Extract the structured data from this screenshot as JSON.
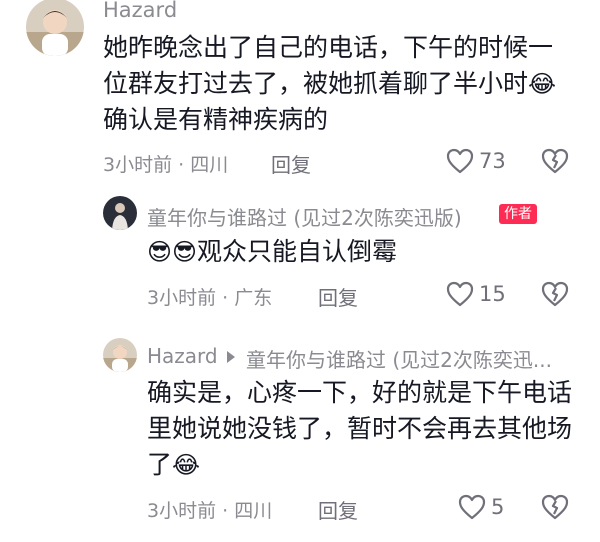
{
  "comments": [
    {
      "username": "Hazard",
      "text_lines": [
        "她昨晚念出了自己的电话，下午的时候一",
        "位群友打过去了，被她抓着聊了半小时",
        "确认是有精神疾病的"
      ],
      "emoji": "😂",
      "time": "3小时前 · 四川",
      "reply_label": "回复",
      "like_count": "73"
    },
    {
      "username": "童年你与谁路过 (见过2次陈奕迅版)",
      "badge": "作者",
      "emoji_prefix": "😎😎",
      "text": "观众只能自认倒霉",
      "time": "3小时前 · 广东",
      "reply_label": "回复",
      "like_count": "15"
    },
    {
      "username": "Hazard",
      "reply_to": "童年你与谁路过 (见过2次陈奕迅...",
      "text_lines": [
        "确实是，心疼一下，好的就是下午电话",
        "里她说她没钱了，暂时不会再去其他场",
        "了"
      ],
      "emoji": "😂",
      "time": "3小时前 · 四川",
      "reply_label": "回复",
      "like_count": "5"
    }
  ],
  "colors": {
    "meta_gray": "#8a8b91",
    "text_dark": "#161823",
    "badge_red": "#fe2c55"
  },
  "icons": [
    "heart-icon",
    "dislike-heart-icon",
    "reply-arrow-icon"
  ]
}
